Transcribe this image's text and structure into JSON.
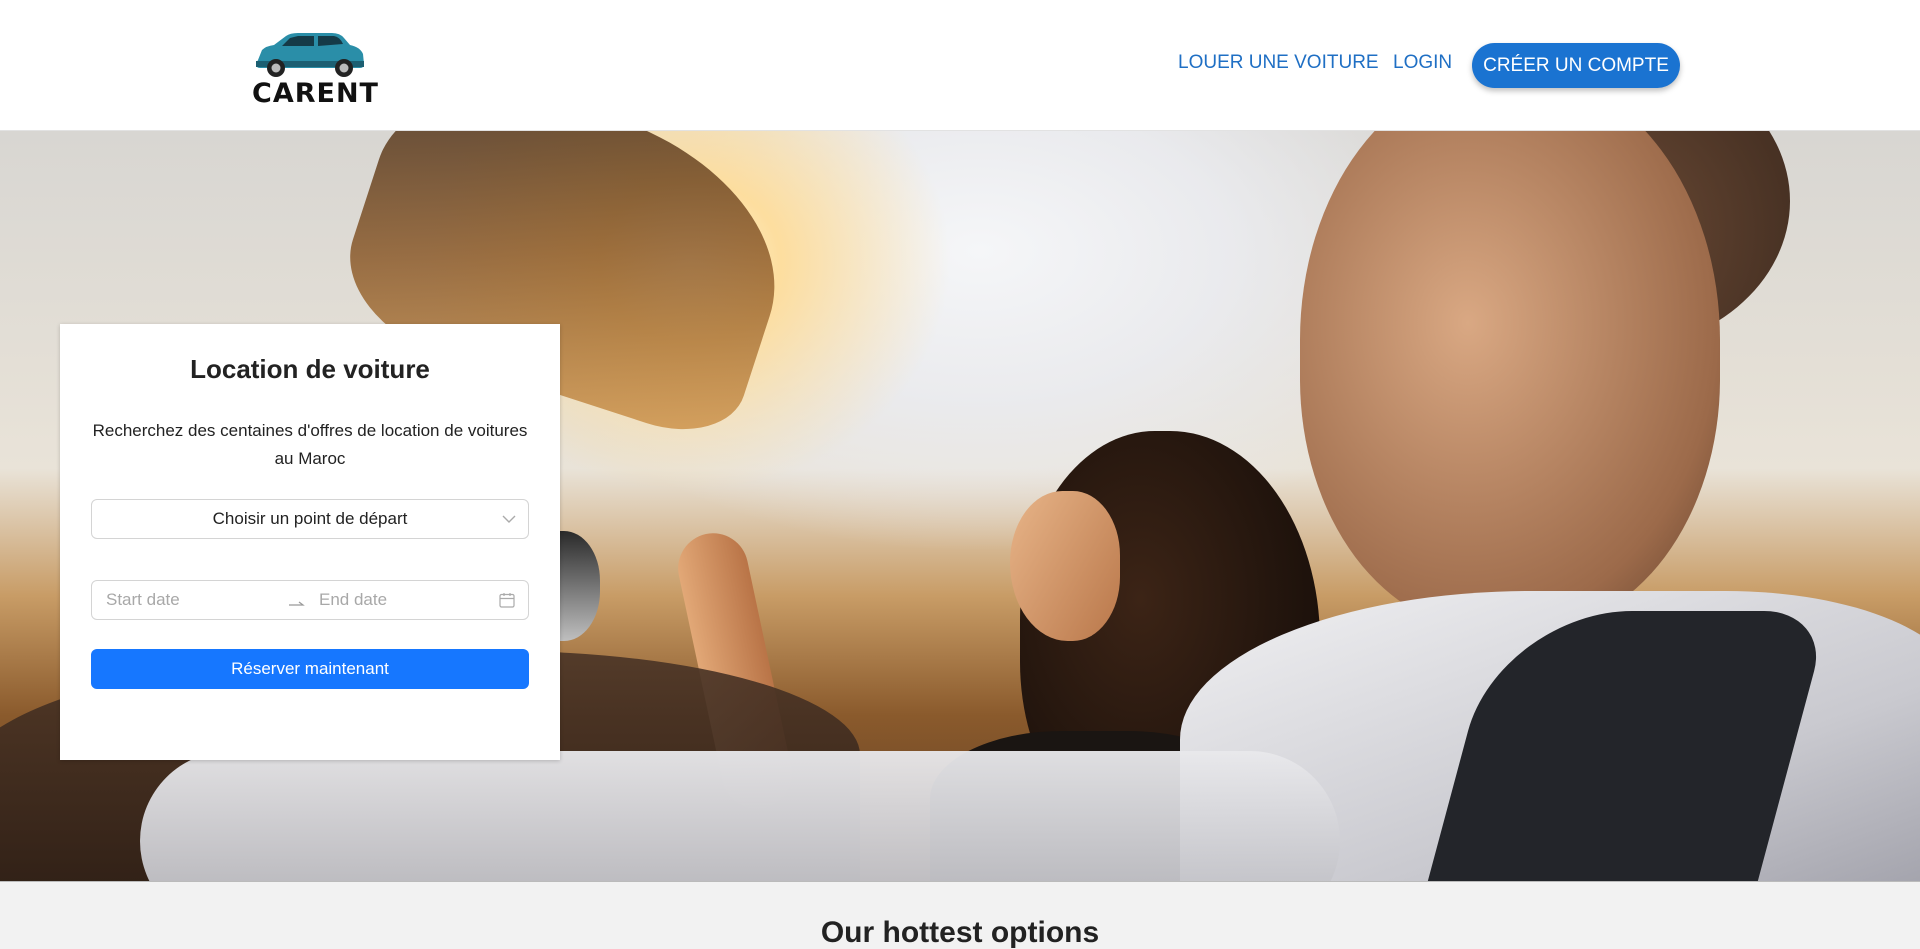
{
  "brand": {
    "name": "CARENT",
    "logo_icon": "car-icon",
    "car_color": "#2a8ea8"
  },
  "nav": {
    "rent_label": "LOUER UNE VOITURE",
    "login_label": "LOGIN",
    "signup_label": "CRÉER UN COMPTE"
  },
  "colors": {
    "nav_link": "#1f6fc4",
    "signup_bg": "#1a73d1",
    "primary_button": "#1677ff"
  },
  "booking": {
    "title": "Location de voiture",
    "subtitle": "Recherchez des centaines d'offres de location de voitures au Maroc",
    "departure_select": {
      "value": "Choisir un point de départ",
      "icon": "chevron-down-icon"
    },
    "date_range": {
      "start_placeholder": "Start date",
      "end_placeholder": "End date",
      "separator_icon": "arrow-right-icon",
      "icon": "calendar-icon"
    },
    "submit_label": "Réserver maintenant"
  },
  "hero": {
    "image": "couple-in-convertible-sunset-photo"
  },
  "section": {
    "title": "Our hottest options"
  }
}
